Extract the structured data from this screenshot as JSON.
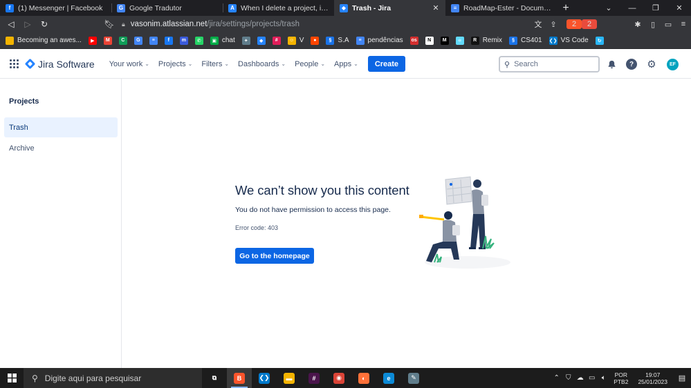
{
  "browser": {
    "tabs": [
      {
        "title": "(1) Messenger | Facebook",
        "icon": "facebook-icon",
        "color": "#1877f2",
        "glyph": "f",
        "active": false
      },
      {
        "title": "Google Tradutor",
        "icon": "google-translate-icon",
        "color": "#4285f4",
        "glyph": "G",
        "active": false
      },
      {
        "title": "When I delete a project, it is moved",
        "icon": "atlassian-icon",
        "color": "#2684ff",
        "glyph": "A",
        "active": false
      },
      {
        "title": "Trash - Jira",
        "icon": "jira-icon",
        "color": "#2684ff",
        "glyph": "◆",
        "active": true
      },
      {
        "title": "RoadMap-Ester - Documentos Google",
        "icon": "google-docs-icon",
        "color": "#4285f4",
        "glyph": "≡",
        "active": false
      }
    ],
    "url_host": "vasonim.atlassian.net",
    "url_path": "/jira/settings/projects/trash",
    "brave_badge": "2",
    "alert_badge": "2"
  },
  "bookmarks": [
    {
      "label": "Becoming an awes...",
      "icon": "folder-icon",
      "color": "#f4b400",
      "glyph": ""
    },
    {
      "label": "",
      "icon": "youtube-icon",
      "color": "#ff0000",
      "glyph": "▶"
    },
    {
      "label": "",
      "icon": "gmail-icon",
      "color": "#ea4335",
      "glyph": "M"
    },
    {
      "label": "",
      "icon": "google-classroom-icon",
      "color": "#0f9d58",
      "glyph": "C"
    },
    {
      "label": "",
      "icon": "google-translate-icon",
      "color": "#4285f4",
      "glyph": "G"
    },
    {
      "label": "",
      "icon": "google-docs-icon",
      "color": "#4285f4",
      "glyph": "≡"
    },
    {
      "label": "",
      "icon": "facebook-icon",
      "color": "#1877f2",
      "glyph": "f"
    },
    {
      "label": "",
      "icon": "messenger-icon",
      "color": "#3b5bdb",
      "glyph": "m"
    },
    {
      "label": "",
      "icon": "whatsapp-icon",
      "color": "#25d366",
      "glyph": "✆"
    },
    {
      "label": "chat",
      "icon": "chat-icon",
      "color": "#00ac47",
      "glyph": "▣"
    },
    {
      "label": "",
      "icon": "extension-icon",
      "color": "#607d8b",
      "glyph": "✦"
    },
    {
      "label": "",
      "icon": "jira-icon",
      "color": "#2684ff",
      "glyph": "◆"
    },
    {
      "label": "",
      "icon": "slack-icon",
      "color": "#e01e5a",
      "glyph": "#"
    },
    {
      "label": "V",
      "icon": "emoji-icon",
      "color": "#f4b400",
      "glyph": "☺"
    },
    {
      "label": "",
      "icon": "reddit-icon",
      "color": "#ff4500",
      "glyph": "●"
    },
    {
      "label": "S.A",
      "icon": "link-icon",
      "color": "#1a73e8",
      "glyph": "§"
    },
    {
      "label": "pendências",
      "icon": "google-docs-icon",
      "color": "#4285f4",
      "glyph": "≡"
    },
    {
      "label": "",
      "icon": "os-icon",
      "color": "#d32f2f",
      "glyph": "os"
    },
    {
      "label": "",
      "icon": "notion-icon",
      "color": "#ffffff",
      "glyph": "N"
    },
    {
      "label": "",
      "icon": "medium-icon",
      "color": "#000000",
      "glyph": "M"
    },
    {
      "label": "",
      "icon": "react-icon",
      "color": "#61dafb",
      "glyph": "⚛"
    },
    {
      "label": "Remix",
      "icon": "remix-icon",
      "color": "#121212",
      "glyph": "R"
    },
    {
      "label": "CS401",
      "icon": "link-icon",
      "color": "#1a73e8",
      "glyph": "§"
    },
    {
      "label": "VS Code",
      "icon": "vscode-icon",
      "color": "#007acc",
      "glyph": "❮❯"
    },
    {
      "label": "",
      "icon": "extension-icon",
      "color": "#29b6f6",
      "glyph": "↻"
    }
  ],
  "jira": {
    "product": "Jira Software",
    "nav": [
      {
        "label": "Your work",
        "name": "nav-your-work"
      },
      {
        "label": "Projects",
        "name": "nav-projects"
      },
      {
        "label": "Filters",
        "name": "nav-filters"
      },
      {
        "label": "Dashboards",
        "name": "nav-dashboards"
      },
      {
        "label": "People",
        "name": "nav-people"
      },
      {
        "label": "Apps",
        "name": "nav-apps"
      }
    ],
    "create_label": "Create",
    "search_placeholder": "Search",
    "avatar_initials": "EF",
    "accent": "#0c66e4"
  },
  "sidebar": {
    "heading": "Projects",
    "items": [
      {
        "label": "Trash",
        "selected": true
      },
      {
        "label": "Archive",
        "selected": false
      }
    ]
  },
  "error": {
    "title": "We can’t show you this content",
    "message": "You do not have permission to access this page.",
    "code": "Error code: 403",
    "button": "Go to the homepage"
  },
  "taskbar": {
    "search_placeholder": "Digite aqui para pesquisar",
    "apps": [
      {
        "icon": "task-view-icon",
        "color": "#1c1c1c",
        "glyph": "⧉",
        "active": false
      },
      {
        "icon": "brave-icon",
        "color": "#fb542b",
        "glyph": "B",
        "active": true
      },
      {
        "icon": "vscode-icon",
        "color": "#007acc",
        "glyph": "❮❯",
        "active": false
      },
      {
        "icon": "file-explorer-icon",
        "color": "#f4b400",
        "glyph": "▬",
        "active": false
      },
      {
        "icon": "slack-icon",
        "color": "#4a154b",
        "glyph": "#",
        "active": false
      },
      {
        "icon": "chrome-icon",
        "color": "#db4437",
        "glyph": "◉",
        "active": false
      },
      {
        "icon": "firefox-icon",
        "color": "#ff7139",
        "glyph": "◐",
        "active": false
      },
      {
        "icon": "edge-icon",
        "color": "#0c8ad6",
        "glyph": "e",
        "active": false
      },
      {
        "icon": "app-icon",
        "color": "#607d8b",
        "glyph": "✎",
        "active": false
      }
    ],
    "lang_top": "POR",
    "lang_bottom": "PTB2",
    "time": "19:07",
    "date": "25/01/2023"
  }
}
